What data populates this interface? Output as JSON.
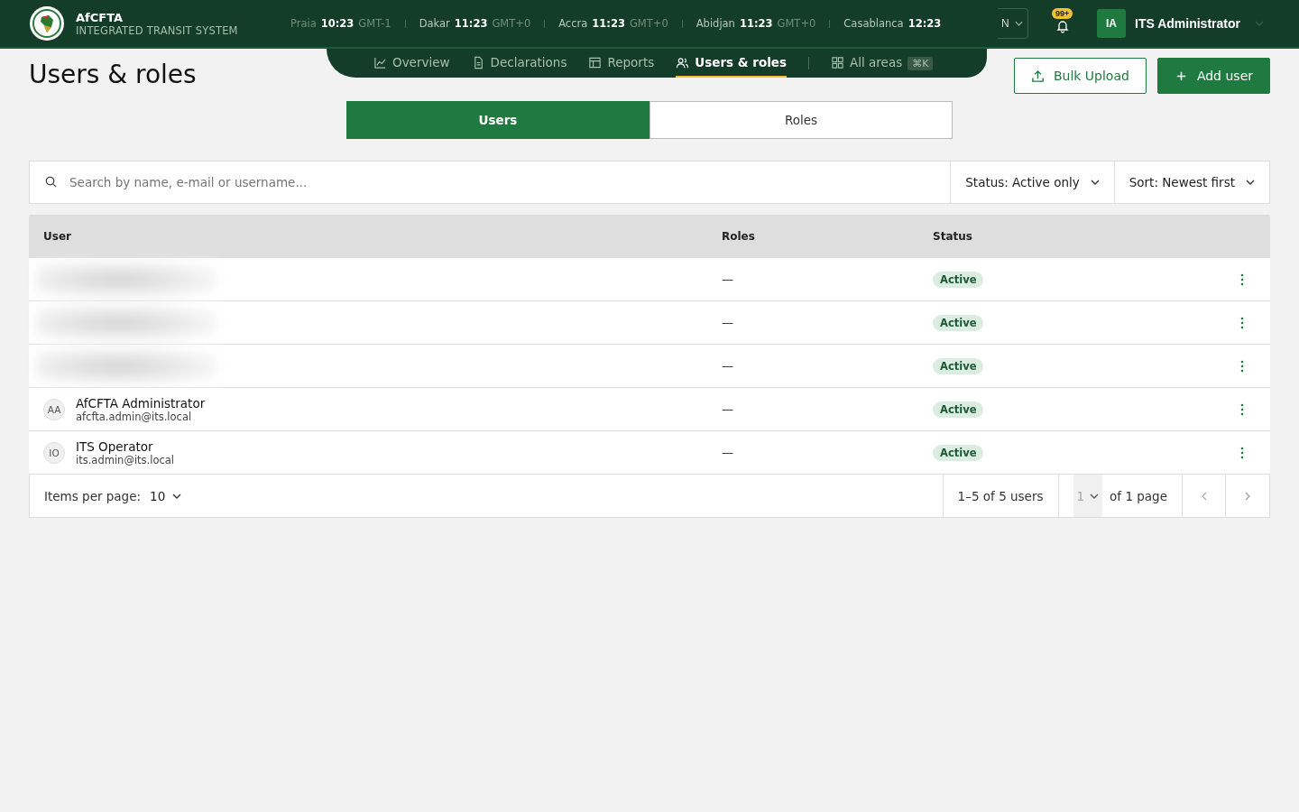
{
  "brand": {
    "name": "AfCFTA",
    "subtitle": "INTEGRATED TRANSIT SYSTEM"
  },
  "clocks": [
    {
      "city": "Praia",
      "time": "10:23",
      "zone": "GMT-1"
    },
    {
      "city": "Dakar",
      "time": "11:23",
      "zone": "GMT+0"
    },
    {
      "city": "Accra",
      "time": "11:23",
      "zone": "GMT+0"
    },
    {
      "city": "Abidjan",
      "time": "11:23",
      "zone": "GMT+0"
    },
    {
      "city": "Casablanca",
      "time": "12:23"
    }
  ],
  "language": "N",
  "notifications": "99+",
  "user": {
    "initials": "IA",
    "name": "ITS Administrator"
  },
  "nav": [
    {
      "label": "Overview",
      "selected": false
    },
    {
      "label": "Declarations",
      "selected": false
    },
    {
      "label": "Reports",
      "selected": false
    },
    {
      "label": "Users & roles",
      "selected": true
    }
  ],
  "all_areas": {
    "label": "All areas",
    "shortcut": "⌘K"
  },
  "page_title": "Users & roles",
  "actions": {
    "bulk": "Bulk Upload",
    "add": "Add user"
  },
  "segments": [
    {
      "label": "Users",
      "selected": true
    },
    {
      "label": "Roles",
      "selected": false
    }
  ],
  "search": {
    "placeholder": "Search by name, e-mail or username..."
  },
  "filters": [
    "Status: Active only",
    "Sort: Newest first"
  ],
  "table": {
    "columns": [
      "User",
      "Roles",
      "Status"
    ],
    "rows": [
      {
        "kind": "redacted",
        "roles": "—",
        "status": "Active"
      },
      {
        "kind": "redacted",
        "roles": "—",
        "status": "Active"
      },
      {
        "kind": "redacted",
        "roles": "—",
        "status": "Active"
      },
      {
        "kind": "user",
        "initials": "AA",
        "name": "AfCFTA Administrator",
        "email": "afcfta.admin@its.local",
        "roles": "—",
        "status": "Active"
      },
      {
        "kind": "user",
        "initials": "IO",
        "name": "ITS Operator",
        "email": "its.admin@its.local",
        "roles": "—",
        "status": "Active"
      }
    ]
  },
  "pagination": {
    "label": "Items per page:",
    "per_page": "10",
    "range": "1–5 of 5 users",
    "page": "1",
    "of_pages": "of 1 page"
  }
}
